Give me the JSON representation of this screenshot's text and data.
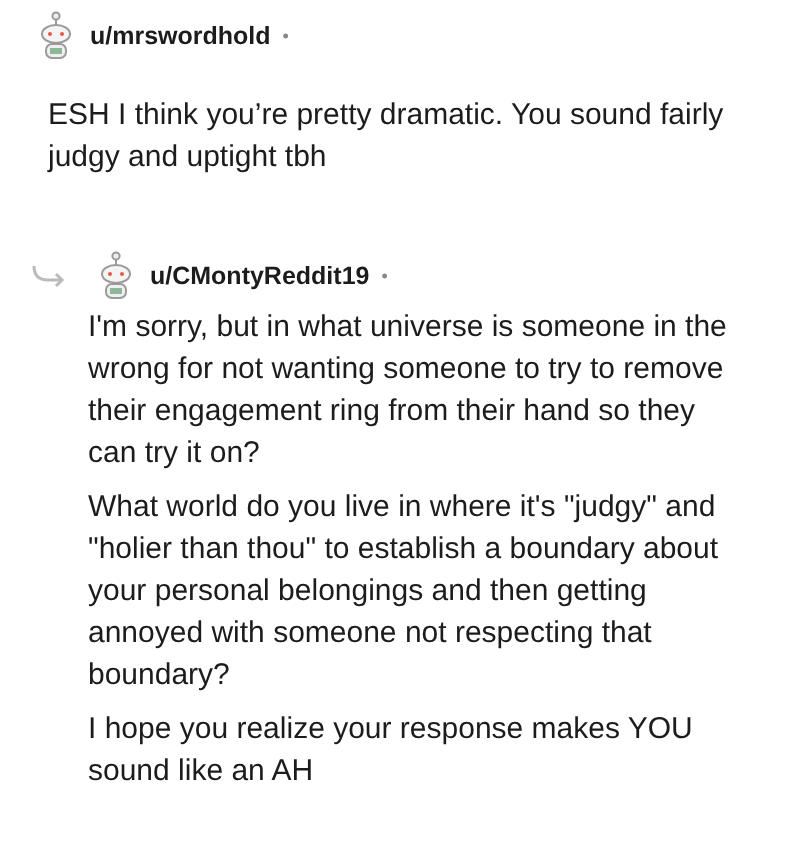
{
  "comments": [
    {
      "username": "u/mrswordhold",
      "separator": "•",
      "is_reply": false,
      "paragraphs": [
        "ESH I think you’re pretty dramatic. You sound fairly judgy and uptight tbh"
      ]
    },
    {
      "username": "u/CMontyReddit19",
      "separator": "•",
      "is_reply": true,
      "paragraphs": [
        "I'm sorry, but in what universe is someone in the wrong for not wanting someone to try to remove their engagement ring from their hand so they can try it on?",
        "What world do you live in where it's \"judgy\" and \"holier than thou\" to establish a boundary about your personal belongings and then getting annoyed with someone not respecting that boundary?",
        "I hope you realize your response makes YOU sound like an AH"
      ]
    }
  ]
}
